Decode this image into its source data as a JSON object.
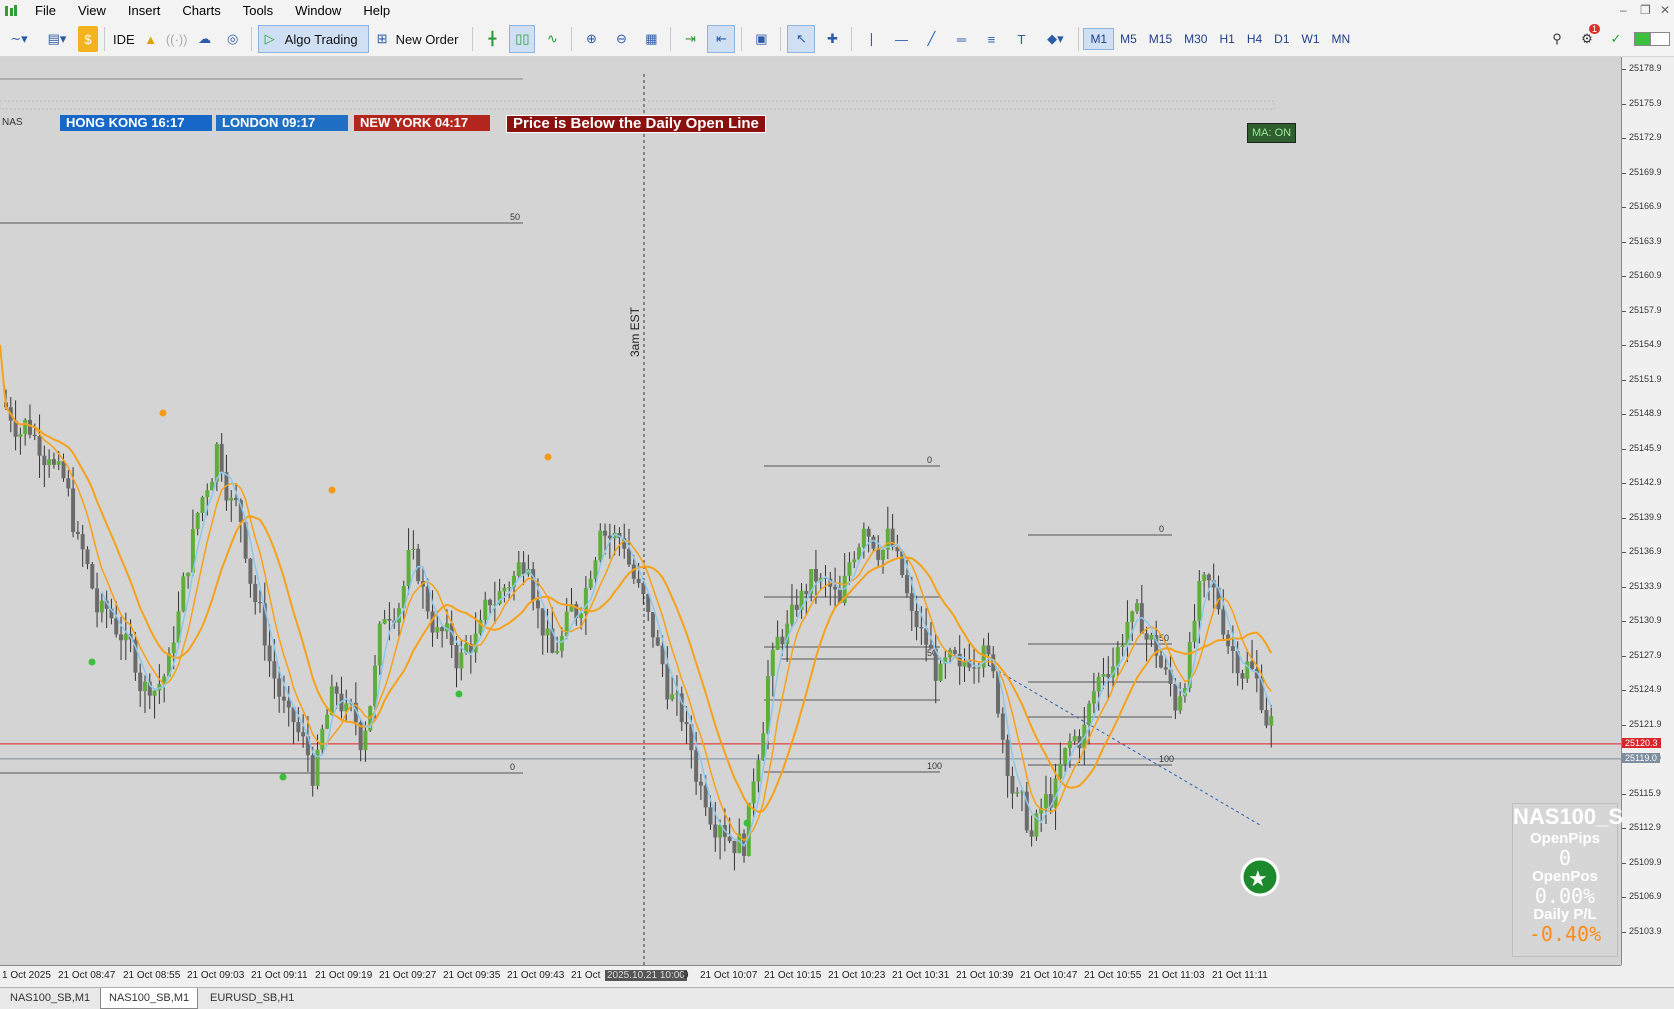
{
  "menu": [
    "File",
    "View",
    "Insert",
    "Charts",
    "Tools",
    "Window",
    "Help"
  ],
  "toolbar": {
    "ide": "IDE",
    "algo_trading": "Algo Trading",
    "new_order": "New Order",
    "timeframes": [
      "M1",
      "M5",
      "M15",
      "M30",
      "H1",
      "H4",
      "D1",
      "W1",
      "MN"
    ],
    "active_timeframe": "M1",
    "notification_count": "1"
  },
  "sessions": {
    "hong_kong": "HONG KONG 16:17",
    "london": "LONDON  09:17",
    "new_york": "NEW YORK 04:17",
    "alert": "Price is Below the Daily Open Line",
    "symbol_short": "NAS"
  },
  "chart": {
    "ma_status": "MA: ON",
    "vline_label": "3am EST",
    "fib_labels": {
      "a": "50",
      "b": "0",
      "c": "0",
      "d": "50",
      "e": "100",
      "f": "0",
      "g": "50",
      "h": "100"
    },
    "red_line_price": "25120.3",
    "gray_line_price": "25119.0",
    "price_ticks": [
      "25178.9",
      "25175.9",
      "25172.9",
      "25169.9",
      "25166.9",
      "25163.9",
      "25160.9",
      "25157.9",
      "25154.9",
      "25151.9",
      "25148.9",
      "25145.9",
      "25142.9",
      "25139.9",
      "25136.9",
      "25133.9",
      "25130.9",
      "25127.9",
      "25124.9",
      "25121.9",
      "25118.9",
      "25115.9",
      "25112.9",
      "25109.9",
      "25106.9",
      "25103.9"
    ],
    "time_ticks": [
      "1 Oct 2025",
      "21 Oct 08:47",
      "21 Oct 08:55",
      "21 Oct 09:03",
      "21 Oct 09:11",
      "21 Oct 09:19",
      "21 Oct 09:27",
      "21 Oct 09:35",
      "21 Oct 09:43",
      "21 Oct",
      "2025.10.21 10:00",
      "9",
      "21 Oct 10:07",
      "21 Oct 10:15",
      "21 Oct 10:23",
      "21 Oct 10:31",
      "21 Oct 10:39",
      "21 Oct 10:47",
      "21 Oct 10:55",
      "21 Oct 11:03",
      "21 Oct 11:11"
    ]
  },
  "panel": {
    "symbol": "NAS100_S",
    "open_pips_label": "OpenPips",
    "open_pips": "0",
    "open_pos_label": "OpenPos",
    "open_pos": "0.00%",
    "daily_pl_label": "Daily P/L",
    "daily_pl": "-0.40%"
  },
  "tabs": [
    "NAS100_SB,M1",
    "NAS100_SB,M1",
    "EURUSD_SB,H1"
  ],
  "active_tab_index": 1,
  "colors": {
    "chart_bg": "#d4d4d4",
    "bull": "#5fae3c",
    "bear": "#6b6b6b",
    "ma_orange": "#f5a21a",
    "ma_blue": "#8cc8ee",
    "red_line": "#e02020",
    "hk": "#1667c7",
    "london": "#1f6fc4",
    "ny": "#b3261e"
  }
}
